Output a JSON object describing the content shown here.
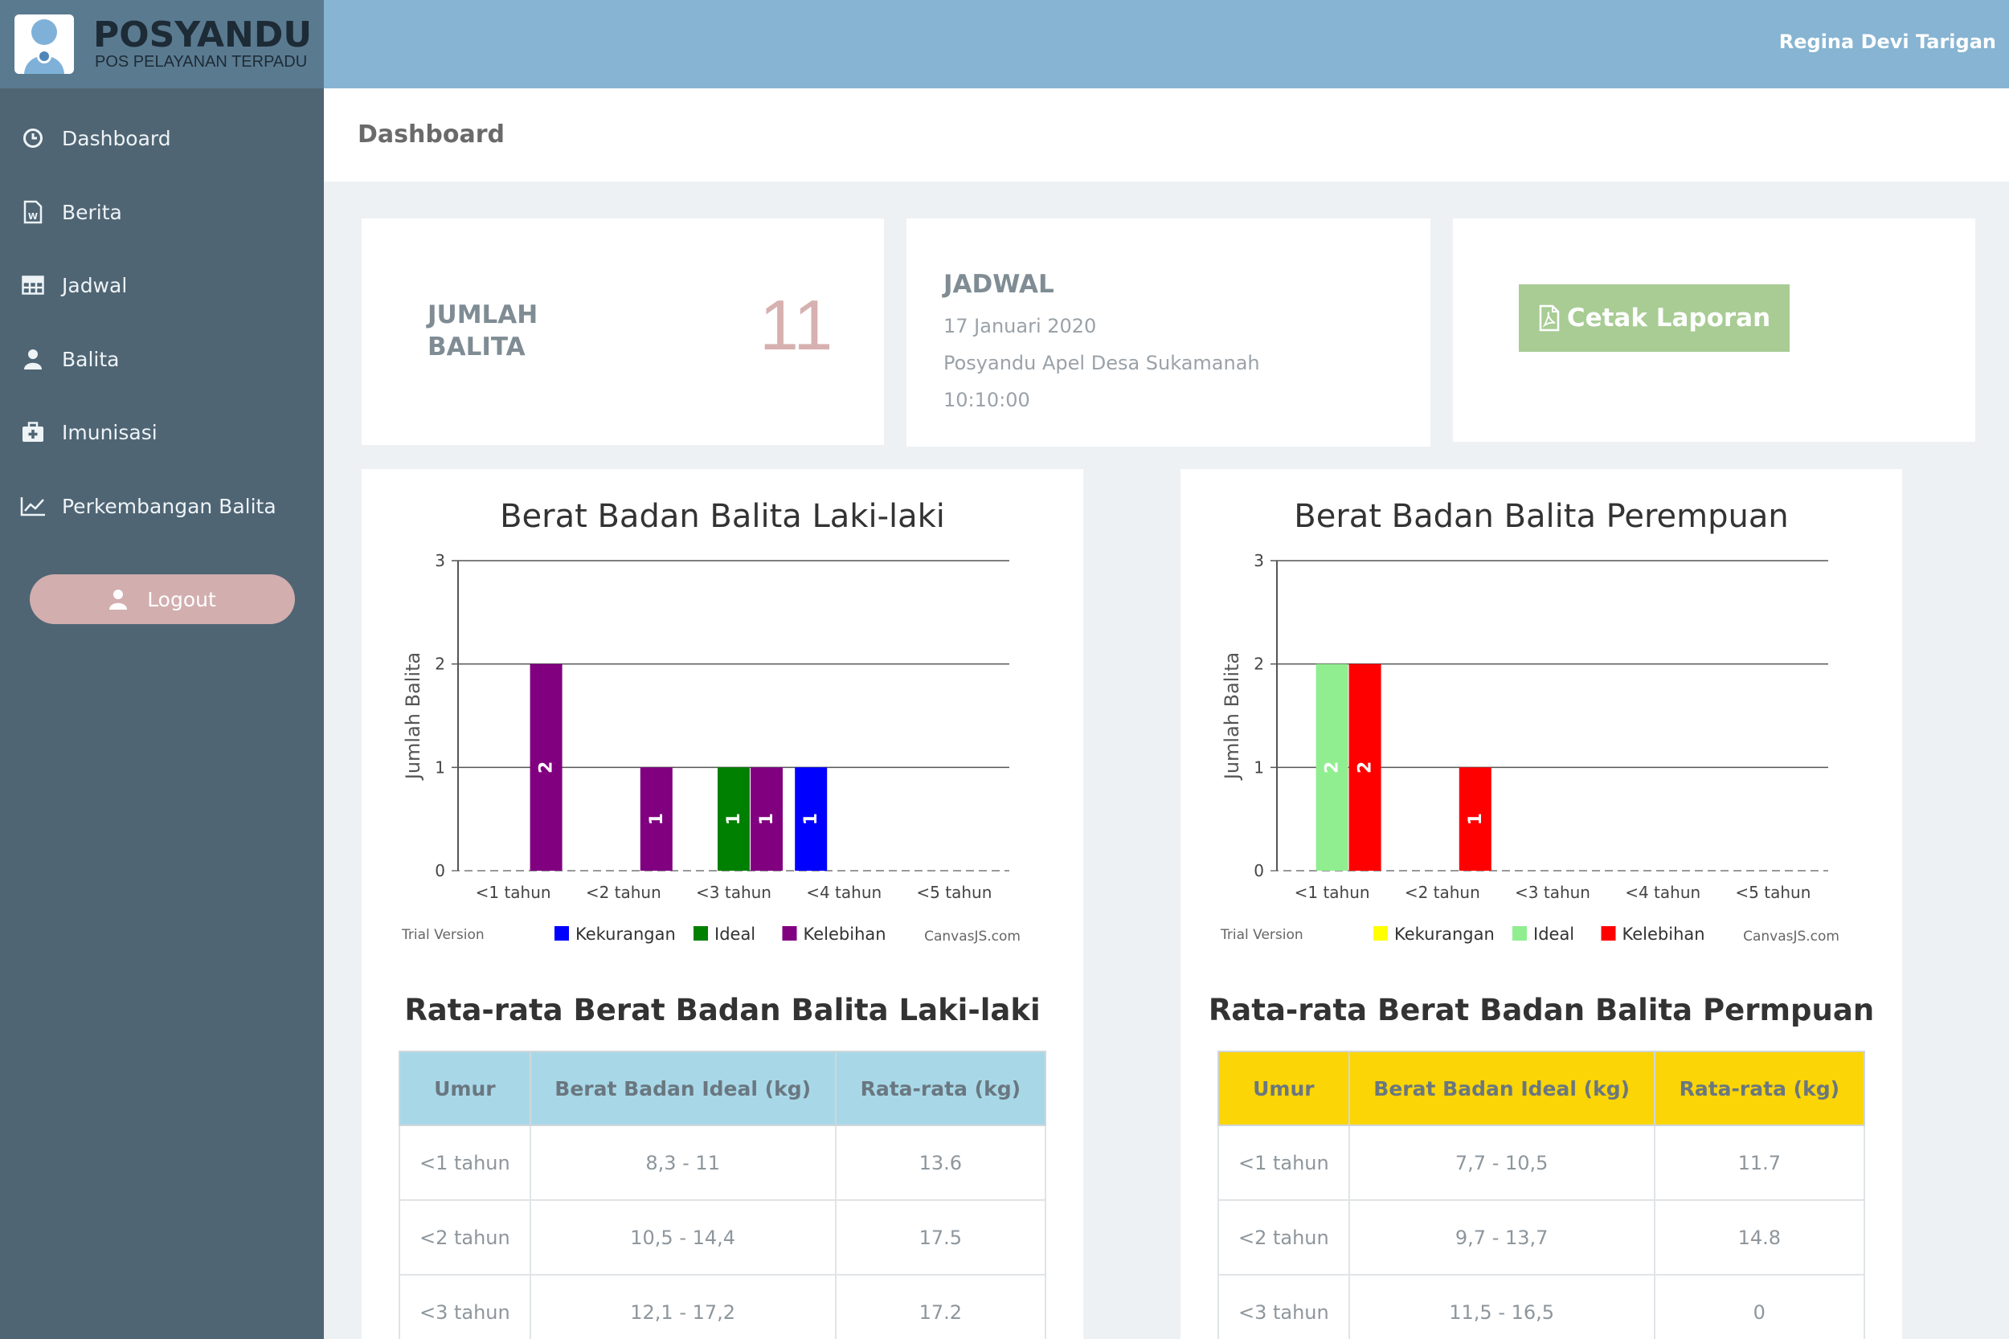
{
  "header": {
    "brand_title": "POSYANDU",
    "brand_subtitle": "POS PELAYANAN TERPADU",
    "username": "Regina Devi Tarigan"
  },
  "sidebar": {
    "items": [
      {
        "label": "Dashboard",
        "icon": "clock-icon"
      },
      {
        "label": "Berita",
        "icon": "document-icon"
      },
      {
        "label": "Jadwal",
        "icon": "table-icon"
      },
      {
        "label": "Balita",
        "icon": "user-icon"
      },
      {
        "label": "Imunisasi",
        "icon": "medkit-icon"
      },
      {
        "label": "Perkembangan Balita",
        "icon": "line-chart-icon"
      }
    ],
    "logout_label": "Logout"
  },
  "page": {
    "title": "Dashboard"
  },
  "cards": {
    "jumlah": {
      "label": "JUMLAH BALITA",
      "value": "11"
    },
    "jadwal": {
      "title": "JADWAL",
      "date": "17 Januari 2020",
      "place": "Posyandu Apel Desa Sukamanah",
      "time": "10:10:00"
    },
    "cetak": {
      "label": "Cetak Laporan"
    }
  },
  "chart_data": [
    {
      "type": "bar",
      "title": "Berat Badan Balita Laki-laki",
      "ylabel": "Jumlah Balita",
      "ylim": [
        0,
        3
      ],
      "yticks": [
        0,
        1,
        2,
        3
      ],
      "categories": [
        "<1 tahun",
        "<2 tahun",
        "<3 tahun",
        "<4 tahun",
        "<5 tahun"
      ],
      "series": [
        {
          "name": "Kekurangan",
          "color": "#0000ff",
          "values": [
            0,
            0,
            0,
            1,
            0
          ]
        },
        {
          "name": "Ideal",
          "color": "#008000",
          "values": [
            0,
            0,
            1,
            0,
            0
          ]
        },
        {
          "name": "Kelebihan",
          "color": "#800080",
          "values": [
            2,
            1,
            1,
            0,
            0
          ]
        }
      ],
      "watermark": "Trial Version",
      "credit": "CanvasJS.com",
      "grid": true,
      "legend": "bottom"
    },
    {
      "type": "bar",
      "title": "Berat Badan Balita Perempuan",
      "ylabel": "Jumlah Balita",
      "ylim": [
        0,
        3
      ],
      "yticks": [
        0,
        1,
        2,
        3
      ],
      "categories": [
        "<1 tahun",
        "<2 tahun",
        "<3 tahun",
        "<4 tahun",
        "<5 tahun"
      ],
      "series": [
        {
          "name": "Kekurangan",
          "color": "#ffff00",
          "values": [
            0,
            0,
            0,
            0,
            0
          ]
        },
        {
          "name": "Ideal",
          "color": "#90ee90",
          "values": [
            2,
            0,
            0,
            0,
            0
          ]
        },
        {
          "name": "Kelebihan",
          "color": "#ff0000",
          "values": [
            2,
            1,
            0,
            0,
            0
          ]
        }
      ],
      "watermark": "Trial Version",
      "credit": "CanvasJS.com",
      "grid": true,
      "legend": "bottom"
    }
  ],
  "tables": {
    "laki": {
      "title": "Rata-rata Berat Badan Balita Laki-laki",
      "headers": [
        "Umur",
        "Berat Badan Ideal (kg)",
        "Rata-rata (kg)"
      ],
      "rows": [
        [
          "<1 tahun",
          "8,3 - 11",
          "13.6"
        ],
        [
          "<2 tahun",
          "10,5 - 14,4",
          "17.5"
        ],
        [
          "<3 tahun",
          "12,1 - 17,2",
          "17.2"
        ]
      ]
    },
    "perempuan": {
      "title": "Rata-rata Berat Badan Balita Permpuan",
      "headers": [
        "Umur",
        "Berat Badan Ideal (kg)",
        "Rata-rata (kg)"
      ],
      "rows": [
        [
          "<1 tahun",
          "7,7 - 10,5",
          "11.7"
        ],
        [
          "<2 tahun",
          "9,7 - 13,7",
          "14.8"
        ],
        [
          "<3 tahun",
          "11,5 - 16,5",
          "0"
        ]
      ]
    }
  }
}
